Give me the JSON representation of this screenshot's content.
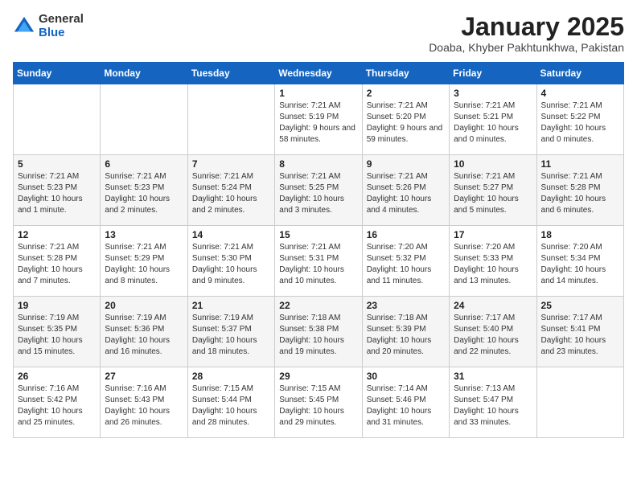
{
  "header": {
    "logo_general": "General",
    "logo_blue": "Blue",
    "month_title": "January 2025",
    "subtitle": "Doaba, Khyber Pakhtunkhwa, Pakistan"
  },
  "days_of_week": [
    "Sunday",
    "Monday",
    "Tuesday",
    "Wednesday",
    "Thursday",
    "Friday",
    "Saturday"
  ],
  "weeks": [
    [
      {
        "day": "",
        "content": ""
      },
      {
        "day": "",
        "content": ""
      },
      {
        "day": "",
        "content": ""
      },
      {
        "day": "1",
        "content": "Sunrise: 7:21 AM\nSunset: 5:19 PM\nDaylight: 9 hours and 58 minutes."
      },
      {
        "day": "2",
        "content": "Sunrise: 7:21 AM\nSunset: 5:20 PM\nDaylight: 9 hours and 59 minutes."
      },
      {
        "day": "3",
        "content": "Sunrise: 7:21 AM\nSunset: 5:21 PM\nDaylight: 10 hours and 0 minutes."
      },
      {
        "day": "4",
        "content": "Sunrise: 7:21 AM\nSunset: 5:22 PM\nDaylight: 10 hours and 0 minutes."
      }
    ],
    [
      {
        "day": "5",
        "content": "Sunrise: 7:21 AM\nSunset: 5:23 PM\nDaylight: 10 hours and 1 minute."
      },
      {
        "day": "6",
        "content": "Sunrise: 7:21 AM\nSunset: 5:23 PM\nDaylight: 10 hours and 2 minutes."
      },
      {
        "day": "7",
        "content": "Sunrise: 7:21 AM\nSunset: 5:24 PM\nDaylight: 10 hours and 2 minutes."
      },
      {
        "day": "8",
        "content": "Sunrise: 7:21 AM\nSunset: 5:25 PM\nDaylight: 10 hours and 3 minutes."
      },
      {
        "day": "9",
        "content": "Sunrise: 7:21 AM\nSunset: 5:26 PM\nDaylight: 10 hours and 4 minutes."
      },
      {
        "day": "10",
        "content": "Sunrise: 7:21 AM\nSunset: 5:27 PM\nDaylight: 10 hours and 5 minutes."
      },
      {
        "day": "11",
        "content": "Sunrise: 7:21 AM\nSunset: 5:28 PM\nDaylight: 10 hours and 6 minutes."
      }
    ],
    [
      {
        "day": "12",
        "content": "Sunrise: 7:21 AM\nSunset: 5:28 PM\nDaylight: 10 hours and 7 minutes."
      },
      {
        "day": "13",
        "content": "Sunrise: 7:21 AM\nSunset: 5:29 PM\nDaylight: 10 hours and 8 minutes."
      },
      {
        "day": "14",
        "content": "Sunrise: 7:21 AM\nSunset: 5:30 PM\nDaylight: 10 hours and 9 minutes."
      },
      {
        "day": "15",
        "content": "Sunrise: 7:21 AM\nSunset: 5:31 PM\nDaylight: 10 hours and 10 minutes."
      },
      {
        "day": "16",
        "content": "Sunrise: 7:20 AM\nSunset: 5:32 PM\nDaylight: 10 hours and 11 minutes."
      },
      {
        "day": "17",
        "content": "Sunrise: 7:20 AM\nSunset: 5:33 PM\nDaylight: 10 hours and 13 minutes."
      },
      {
        "day": "18",
        "content": "Sunrise: 7:20 AM\nSunset: 5:34 PM\nDaylight: 10 hours and 14 minutes."
      }
    ],
    [
      {
        "day": "19",
        "content": "Sunrise: 7:19 AM\nSunset: 5:35 PM\nDaylight: 10 hours and 15 minutes."
      },
      {
        "day": "20",
        "content": "Sunrise: 7:19 AM\nSunset: 5:36 PM\nDaylight: 10 hours and 16 minutes."
      },
      {
        "day": "21",
        "content": "Sunrise: 7:19 AM\nSunset: 5:37 PM\nDaylight: 10 hours and 18 minutes."
      },
      {
        "day": "22",
        "content": "Sunrise: 7:18 AM\nSunset: 5:38 PM\nDaylight: 10 hours and 19 minutes."
      },
      {
        "day": "23",
        "content": "Sunrise: 7:18 AM\nSunset: 5:39 PM\nDaylight: 10 hours and 20 minutes."
      },
      {
        "day": "24",
        "content": "Sunrise: 7:17 AM\nSunset: 5:40 PM\nDaylight: 10 hours and 22 minutes."
      },
      {
        "day": "25",
        "content": "Sunrise: 7:17 AM\nSunset: 5:41 PM\nDaylight: 10 hours and 23 minutes."
      }
    ],
    [
      {
        "day": "26",
        "content": "Sunrise: 7:16 AM\nSunset: 5:42 PM\nDaylight: 10 hours and 25 minutes."
      },
      {
        "day": "27",
        "content": "Sunrise: 7:16 AM\nSunset: 5:43 PM\nDaylight: 10 hours and 26 minutes."
      },
      {
        "day": "28",
        "content": "Sunrise: 7:15 AM\nSunset: 5:44 PM\nDaylight: 10 hours and 28 minutes."
      },
      {
        "day": "29",
        "content": "Sunrise: 7:15 AM\nSunset: 5:45 PM\nDaylight: 10 hours and 29 minutes."
      },
      {
        "day": "30",
        "content": "Sunrise: 7:14 AM\nSunset: 5:46 PM\nDaylight: 10 hours and 31 minutes."
      },
      {
        "day": "31",
        "content": "Sunrise: 7:13 AM\nSunset: 5:47 PM\nDaylight: 10 hours and 33 minutes."
      },
      {
        "day": "",
        "content": ""
      }
    ]
  ]
}
